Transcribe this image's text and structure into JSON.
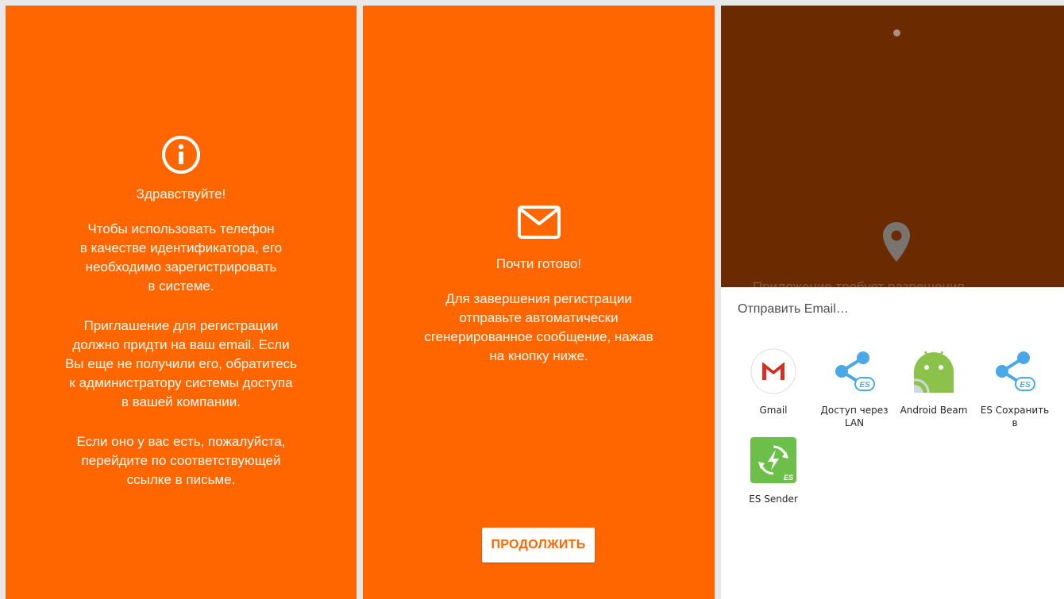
{
  "screen1": {
    "greeting": "Здравствуйте!",
    "paragraph1": "Чтобы использовать телефон\nв качестве идентификатора, его\nнеобходимо зарегистрировать\nв системе.",
    "paragraph2": "Приглашение для регистрации\nдолжно придти на ваш email. Если\nВы еще не получили его, обратитесь\nк администратору системы доступа\nв вашей компании.",
    "paragraph3": "Если оно у вас есть, пожалуйста,\nперейдите по соответствующей\nссылке в письме."
  },
  "screen2": {
    "title": "Почти готово!",
    "paragraph": "Для завершения регистрации\nотправьте автоматически\nсгенерированное сообщение, нажав\nна кнопку ниже.",
    "continue_label": "ПРОДОЛЖИТЬ"
  },
  "screen3": {
    "background_text": "Приложение требует разрешения",
    "share_title": "Отправить Email…",
    "apps": [
      {
        "label": "Gmail",
        "icon": "gmail-icon"
      },
      {
        "label": "Доступ через\nLAN",
        "icon": "es-share-icon"
      },
      {
        "label": "Android Beam",
        "icon": "android-beam-icon"
      },
      {
        "label": "ES Сохранить\nв",
        "icon": "es-share-icon"
      },
      {
        "label": "ES Sender",
        "icon": "es-sender-icon"
      }
    ]
  },
  "colors": {
    "brand_orange": "#ff6600",
    "dark_brown": "#6b2a00",
    "white": "#ffffff"
  }
}
